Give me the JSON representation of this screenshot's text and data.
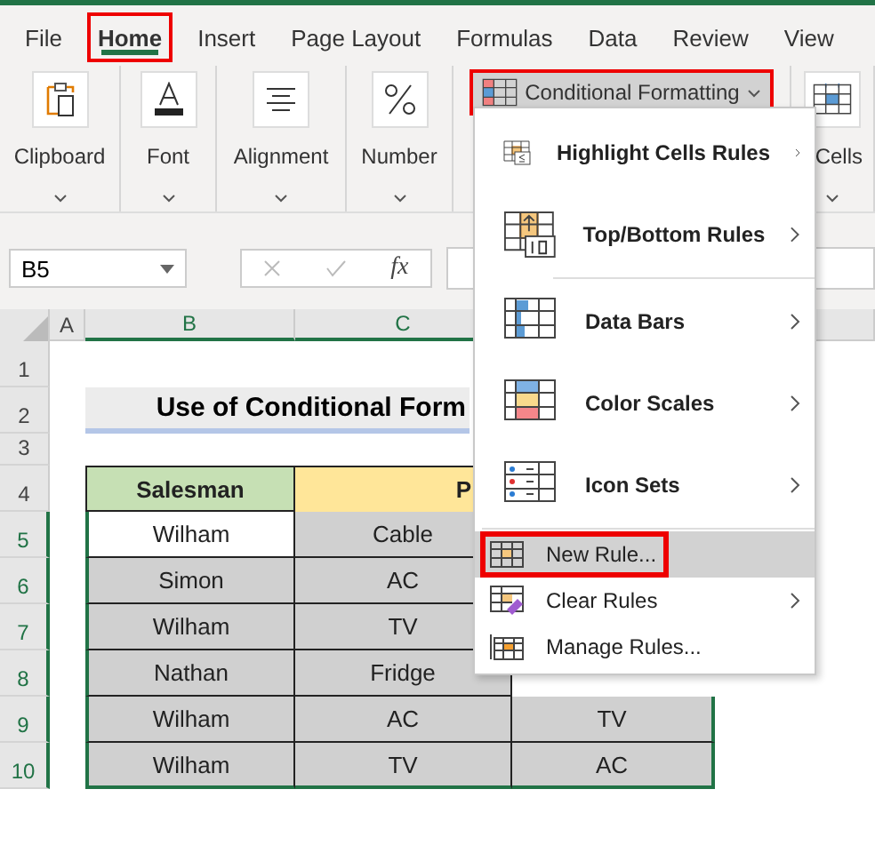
{
  "tabs": [
    {
      "label": "File",
      "selected": false,
      "callout": false
    },
    {
      "label": "Home",
      "selected": true,
      "callout": true
    },
    {
      "label": "Insert",
      "selected": false,
      "callout": false
    },
    {
      "label": "Page Layout",
      "selected": false,
      "callout": false
    },
    {
      "label": "Formulas",
      "selected": false,
      "callout": false
    },
    {
      "label": "Data",
      "selected": false,
      "callout": false
    },
    {
      "label": "Review",
      "selected": false,
      "callout": false
    },
    {
      "label": "View",
      "selected": false,
      "callout": false
    }
  ],
  "ribbon": {
    "groups": [
      {
        "label": "Clipboard",
        "kind": "clipboard"
      },
      {
        "label": "Font",
        "kind": "font"
      },
      {
        "label": "Alignment",
        "kind": "alignment"
      },
      {
        "label": "Number",
        "kind": "number"
      },
      {
        "label": "Conditional Formatting",
        "kind": "conditional",
        "callout": true
      },
      {
        "label": "Cells",
        "kind": "cells"
      }
    ]
  },
  "formula_bar": {
    "name_box": "B5",
    "fx": "fx"
  },
  "sheet": {
    "columns": [
      "A",
      "B",
      "C"
    ],
    "row_numbers": [
      "1",
      "2",
      "3",
      "4",
      "5",
      "6",
      "7",
      "8",
      "9",
      "10"
    ],
    "title": "Use of Conditional Form",
    "headers": [
      "Salesman",
      "P"
    ],
    "rows": [
      {
        "salesman": "Wilham",
        "product": "Cable",
        "active": true
      },
      {
        "salesman": "Simon",
        "product": "AC",
        "active": false
      },
      {
        "salesman": "Wilham",
        "product": "TV",
        "active": false
      },
      {
        "salesman": "Nathan",
        "product": "Fridge",
        "active": false
      },
      {
        "salesman": "Wilham",
        "product": "AC",
        "column_d": "TV",
        "active": false
      },
      {
        "salesman": "Wilham",
        "product": "TV",
        "column_d": "AC",
        "active": false
      }
    ]
  },
  "menu": {
    "items": [
      {
        "label": "Highlight Cells Rules",
        "kind": "large",
        "submenu": true,
        "selected": false,
        "callout": false
      },
      {
        "label": "Top/Bottom Rules",
        "kind": "large",
        "submenu": true,
        "selected": false,
        "callout": false
      },
      {
        "kind": "separator"
      },
      {
        "label": "Data Bars",
        "kind": "large",
        "submenu": true,
        "selected": false,
        "callout": false
      },
      {
        "label": "Color Scales",
        "kind": "large",
        "submenu": true,
        "selected": false,
        "callout": false
      },
      {
        "label": "Icon Sets",
        "kind": "large",
        "submenu": true,
        "selected": false,
        "callout": false
      },
      {
        "kind": "separator"
      },
      {
        "label": "New Rule...",
        "kind": "small",
        "submenu": false,
        "selected": true,
        "callout": true
      },
      {
        "label": "Clear Rules",
        "kind": "small",
        "submenu": true,
        "selected": false,
        "callout": false
      },
      {
        "label": "Manage Rules...",
        "kind": "small",
        "submenu": false,
        "selected": false,
        "callout": false
      }
    ]
  }
}
